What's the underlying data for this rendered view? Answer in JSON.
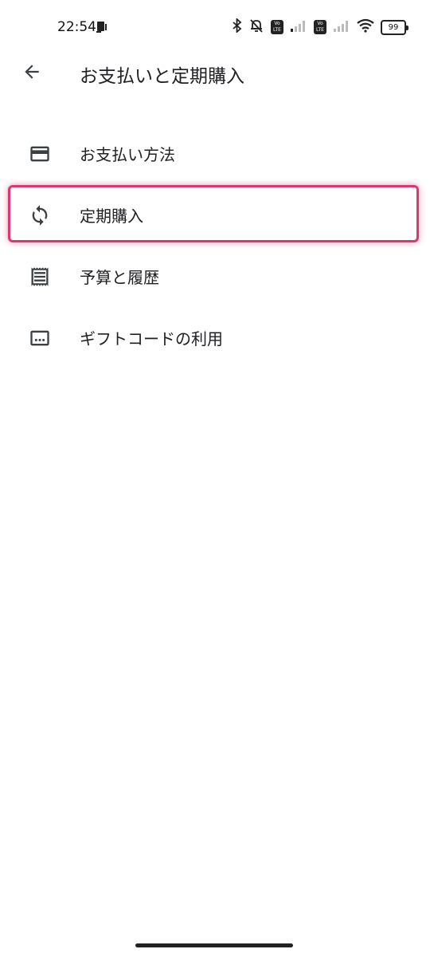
{
  "status_bar": {
    "time": "22:54",
    "battery": "99",
    "volte_label_1": "Vo LTE",
    "volte_label_2": "Vo LTE"
  },
  "app_bar": {
    "title": "お支払いと定期購入"
  },
  "menu": {
    "items": [
      {
        "label": "お支払い方法",
        "icon": "credit-card-icon"
      },
      {
        "label": "定期購入",
        "icon": "sync-icon"
      },
      {
        "label": "予算と履歴",
        "icon": "receipt-icon"
      },
      {
        "label": "ギフトコードの利用",
        "icon": "redeem-code-icon"
      }
    ]
  },
  "colors": {
    "highlight": "#d63a6e",
    "text": "#202124",
    "icon": "#3c4043"
  }
}
